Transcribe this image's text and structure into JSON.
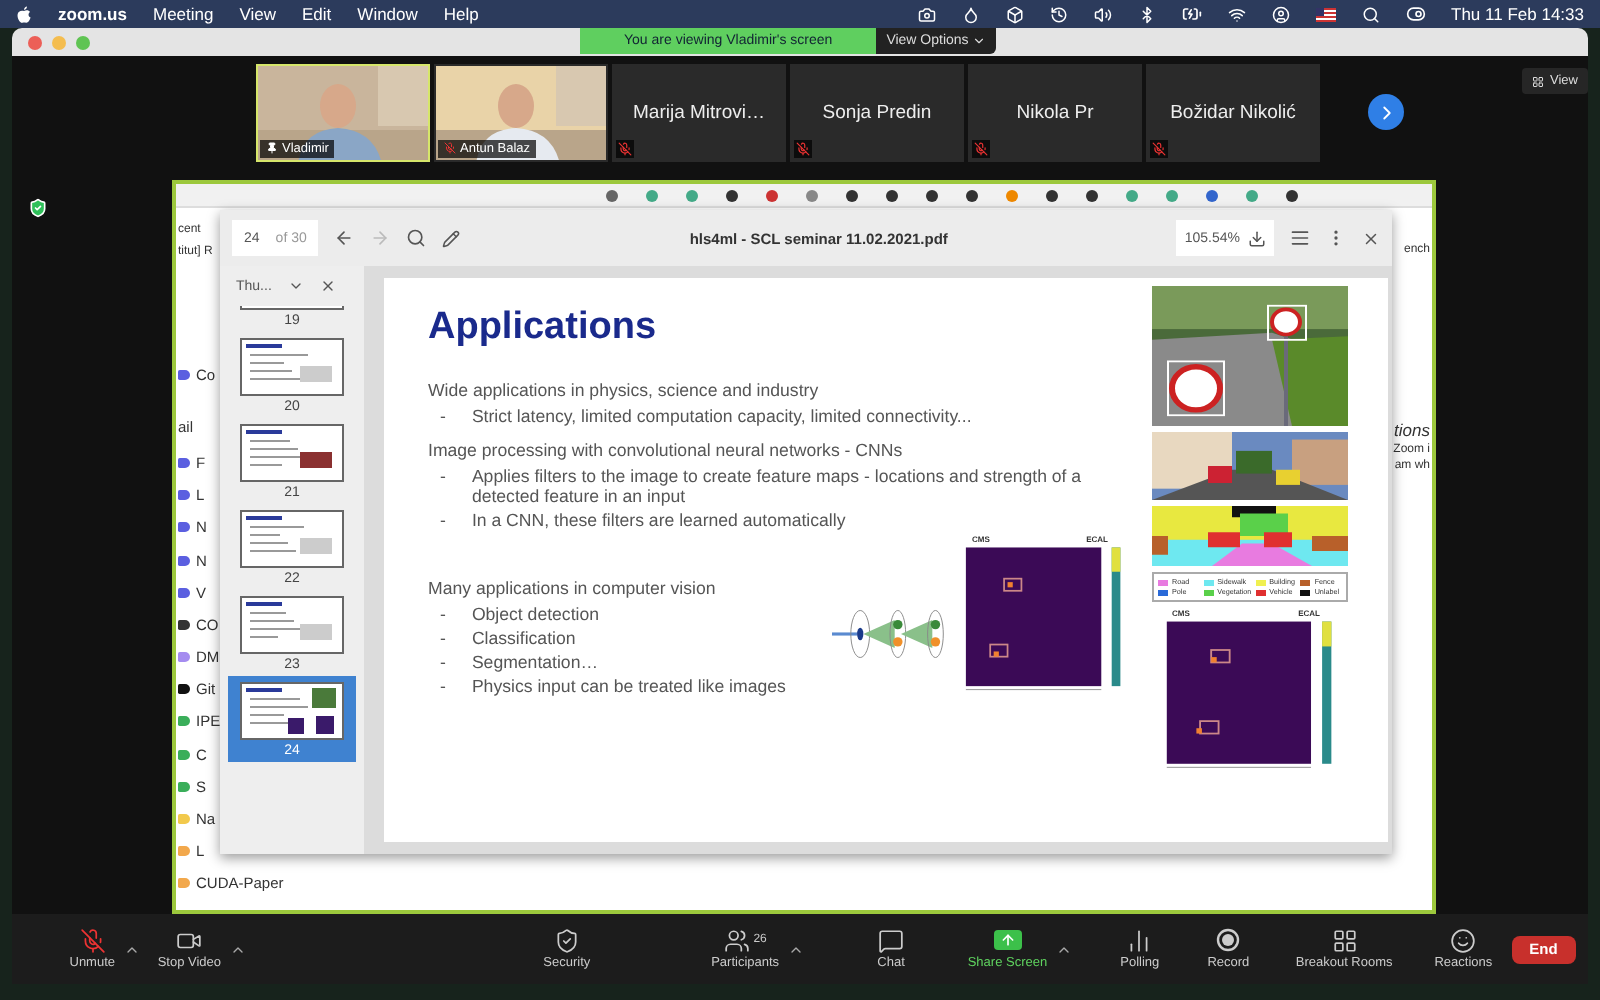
{
  "menubar": {
    "app": "zoom.us",
    "menus": [
      "Meeting",
      "View",
      "Edit",
      "Window",
      "Help"
    ],
    "clock": "Thu 11 Feb  14:33"
  },
  "banner": {
    "message": "You are viewing Vladimir's screen",
    "options": "View Options"
  },
  "participants": [
    {
      "name": "Vladimir",
      "kind": "video",
      "pinned": true,
      "muted": false,
      "selected": true
    },
    {
      "name": "Antun Balaz",
      "kind": "video",
      "pinned": false,
      "muted": true,
      "selected": false
    },
    {
      "name": "Marija Mitrovi…",
      "kind": "name",
      "pinned": false,
      "muted": true,
      "selected": false
    },
    {
      "name": "Sonja Predin",
      "kind": "name",
      "pinned": false,
      "muted": true,
      "selected": false
    },
    {
      "name": "Nikola Pr",
      "kind": "name",
      "pinned": false,
      "muted": true,
      "selected": false
    },
    {
      "name": "Božidar Nikolić",
      "kind": "name",
      "pinned": false,
      "muted": true,
      "selected": false
    }
  ],
  "view_button": "View",
  "shared": {
    "top_texts": [
      "cent",
      "titut] R"
    ],
    "labels": [
      {
        "text": "Co",
        "color": "#5b5fe0"
      },
      {
        "text": "ail"
      },
      {
        "text": "F",
        "color": "#5b5fe0"
      },
      {
        "text": "L",
        "color": "#5b5fe0"
      },
      {
        "text": "N",
        "color": "#5b5fe0"
      },
      {
        "text": "N",
        "color": "#5b5fe0"
      },
      {
        "text": "V",
        "color": "#5b5fe0"
      },
      {
        "text": "CO",
        "color": "#333333"
      },
      {
        "text": "DM",
        "color": "#a58cf0"
      },
      {
        "text": "Git",
        "color": "#111111"
      },
      {
        "text": "IPE",
        "color": "#3aae5a"
      },
      {
        "text": "C",
        "color": "#3aae5a"
      },
      {
        "text": "S",
        "color": "#3aae5a"
      },
      {
        "text": "Na",
        "color": "#f2c94c"
      },
      {
        "text": "L",
        "color": "#f2a84c"
      },
      {
        "text": "CUDA-Paper",
        "color": "#f2a84c"
      }
    ],
    "right_texts": [
      "ench",
      "tions",
      "Zoom i",
      "am wh"
    ]
  },
  "viewer": {
    "page": "24",
    "of": "of 30",
    "title": "hls4ml - SCL seminar 11.02.2021.pdf",
    "zoom": "105.54%",
    "panel": "Thu...",
    "thumbnails": [
      {
        "page": "19",
        "selected": false
      },
      {
        "page": "20",
        "selected": false
      },
      {
        "page": "21",
        "selected": false
      },
      {
        "page": "22",
        "selected": false
      },
      {
        "page": "23",
        "selected": false
      },
      {
        "page": "24",
        "selected": true
      }
    ],
    "slide": {
      "title": "Applications",
      "blocks": [
        {
          "kind": "head",
          "text": "Wide applications in physics, science and industry"
        },
        {
          "kind": "bullet",
          "marker": "-",
          "text": "Strict latency, limited computation capacity, limited connectivity..."
        },
        {
          "kind": "head",
          "text": "Image processing with convolutional neural networks - CNNs"
        },
        {
          "kind": "bullet",
          "marker": "-",
          "text": "Applies filters to the image to create feature maps - locations and strength of a detected feature in an input"
        },
        {
          "kind": "bullet",
          "marker": "-",
          "text": "In a CNN, these filters are learned automatically"
        }
      ],
      "vision": [
        {
          "kind": "head",
          "text": "Many applications in computer vision"
        },
        {
          "kind": "bullet",
          "marker": "-",
          "text": "Object detection"
        },
        {
          "kind": "bullet",
          "marker": "-",
          "text": "Classification"
        },
        {
          "kind": "bullet",
          "marker": "-",
          "text": "Segmentation…"
        },
        {
          "kind": "bullet",
          "marker": "-",
          "text": "Physics input can be treated like images"
        }
      ],
      "legend": [
        {
          "label": "Road",
          "color": "#e87be0"
        },
        {
          "label": "Sidewalk",
          "color": "#6ee8f0"
        },
        {
          "label": "Building",
          "color": "#f0f050"
        },
        {
          "label": "Fence",
          "color": "#b8602a"
        },
        {
          "label": "Pole",
          "color": "#2a6ad8"
        },
        {
          "label": "Vegetation",
          "color": "#5ad04a"
        },
        {
          "label": "Vehicle",
          "color": "#e03030"
        },
        {
          "label": "Unlabel",
          "color": "#111111"
        }
      ],
      "plots": [
        {
          "experiment": "CMS",
          "detector": "ECAL"
        },
        {
          "experiment": "CMS",
          "detector": "ECAL"
        }
      ]
    }
  },
  "toolbar": [
    {
      "label": "Unmute",
      "kind": "mic",
      "caret": true,
      "selected": false
    },
    {
      "label": "Stop Video",
      "kind": "video",
      "caret": true,
      "selected": false
    },
    {
      "label": "Security",
      "kind": "security",
      "caret": false,
      "selected": false
    },
    {
      "label": "Participants",
      "kind": "participants",
      "count": "26",
      "caret": true,
      "selected": false
    },
    {
      "label": "Chat",
      "kind": "chat",
      "caret": false,
      "selected": false
    },
    {
      "label": "Share Screen",
      "kind": "share",
      "caret": true,
      "selected": true
    },
    {
      "label": "Polling",
      "kind": "polling",
      "caret": false,
      "selected": false
    },
    {
      "label": "Record",
      "kind": "record",
      "caret": false,
      "selected": false
    },
    {
      "label": "Breakout Rooms",
      "kind": "rooms",
      "caret": false,
      "selected": false
    },
    {
      "label": "Reactions",
      "kind": "reactions",
      "caret": false,
      "selected": false
    }
  ],
  "end_button": "End"
}
